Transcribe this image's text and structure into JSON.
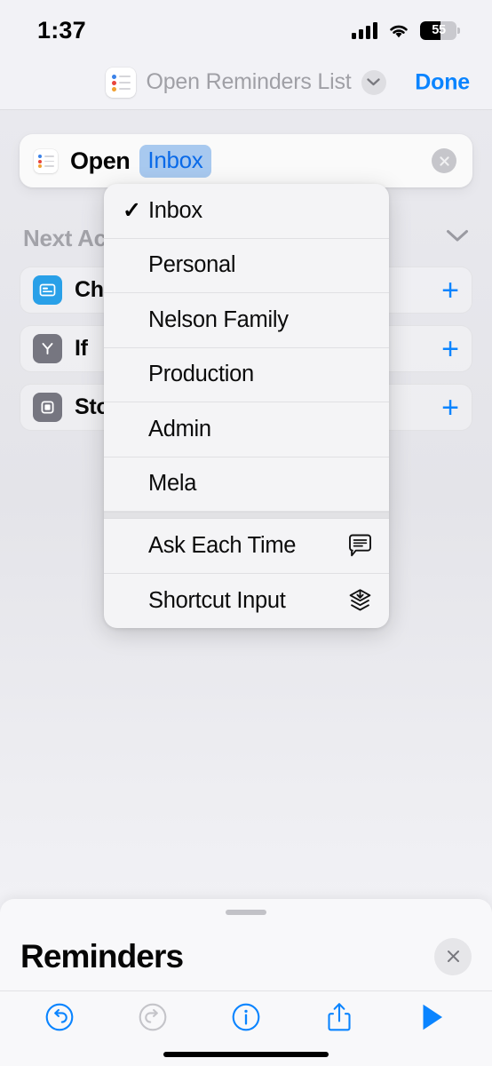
{
  "status_bar": {
    "time": "1:37",
    "signal_icon": "cellular-signal-icon",
    "wifi_icon": "wifi-icon",
    "battery_percent": "55",
    "battery_level": 55
  },
  "nav_header": {
    "app_icon": "reminders-app-icon",
    "title": "Open Reminders List",
    "chevron_icon": "chevron-down-icon",
    "done_label": "Done"
  },
  "action_card": {
    "app_icon": "reminders-app-icon",
    "verb": "Open",
    "token_value": "Inbox",
    "token_color": "#a8c9ef",
    "token_text_color": "#0a6ae8",
    "close_icon": "close-circle-icon"
  },
  "next_action": {
    "title": "Next Action",
    "chevron_icon": "chevron-down-icon",
    "suggestions": [
      {
        "label": "Choose from Menu",
        "icon": "menu-card-icon",
        "icon_color": "#29a0e8",
        "add_icon": "plus-icon"
      },
      {
        "label": "If",
        "icon": "if-branch-icon",
        "icon_color": "#767680",
        "add_icon": "plus-icon"
      },
      {
        "label": "Stop and Output",
        "icon": "stop-square-icon",
        "icon_color": "#767680",
        "add_icon": "plus-icon"
      }
    ]
  },
  "dropdown_menu": {
    "lists": [
      {
        "label": "Inbox",
        "checked": true
      },
      {
        "label": "Personal",
        "checked": false
      },
      {
        "label": "Nelson Family",
        "checked": false
      },
      {
        "label": "Production",
        "checked": false
      },
      {
        "label": "Admin",
        "checked": false
      },
      {
        "label": "Mela",
        "checked": false
      }
    ],
    "variables": [
      {
        "label": "Ask Each Time",
        "icon": "speech-bubble-icon"
      },
      {
        "label": "Shortcut Input",
        "icon": "shortcut-input-layers-icon"
      }
    ]
  },
  "bottom_sheet": {
    "grabber": "sheet-grabber",
    "title": "Reminders",
    "close_icon": "close-icon",
    "toolbar": [
      {
        "name": "undo",
        "icon": "undo-circle-icon",
        "enabled": true,
        "color": "#0a84ff"
      },
      {
        "name": "redo",
        "icon": "redo-circle-icon",
        "enabled": false,
        "color": "#c4c4c9"
      },
      {
        "name": "info",
        "icon": "info-circle-icon",
        "enabled": true,
        "color": "#0a84ff"
      },
      {
        "name": "share",
        "icon": "share-icon",
        "enabled": true,
        "color": "#0a84ff"
      },
      {
        "name": "run",
        "icon": "play-icon",
        "enabled": true,
        "color": "#0a84ff"
      }
    ]
  }
}
